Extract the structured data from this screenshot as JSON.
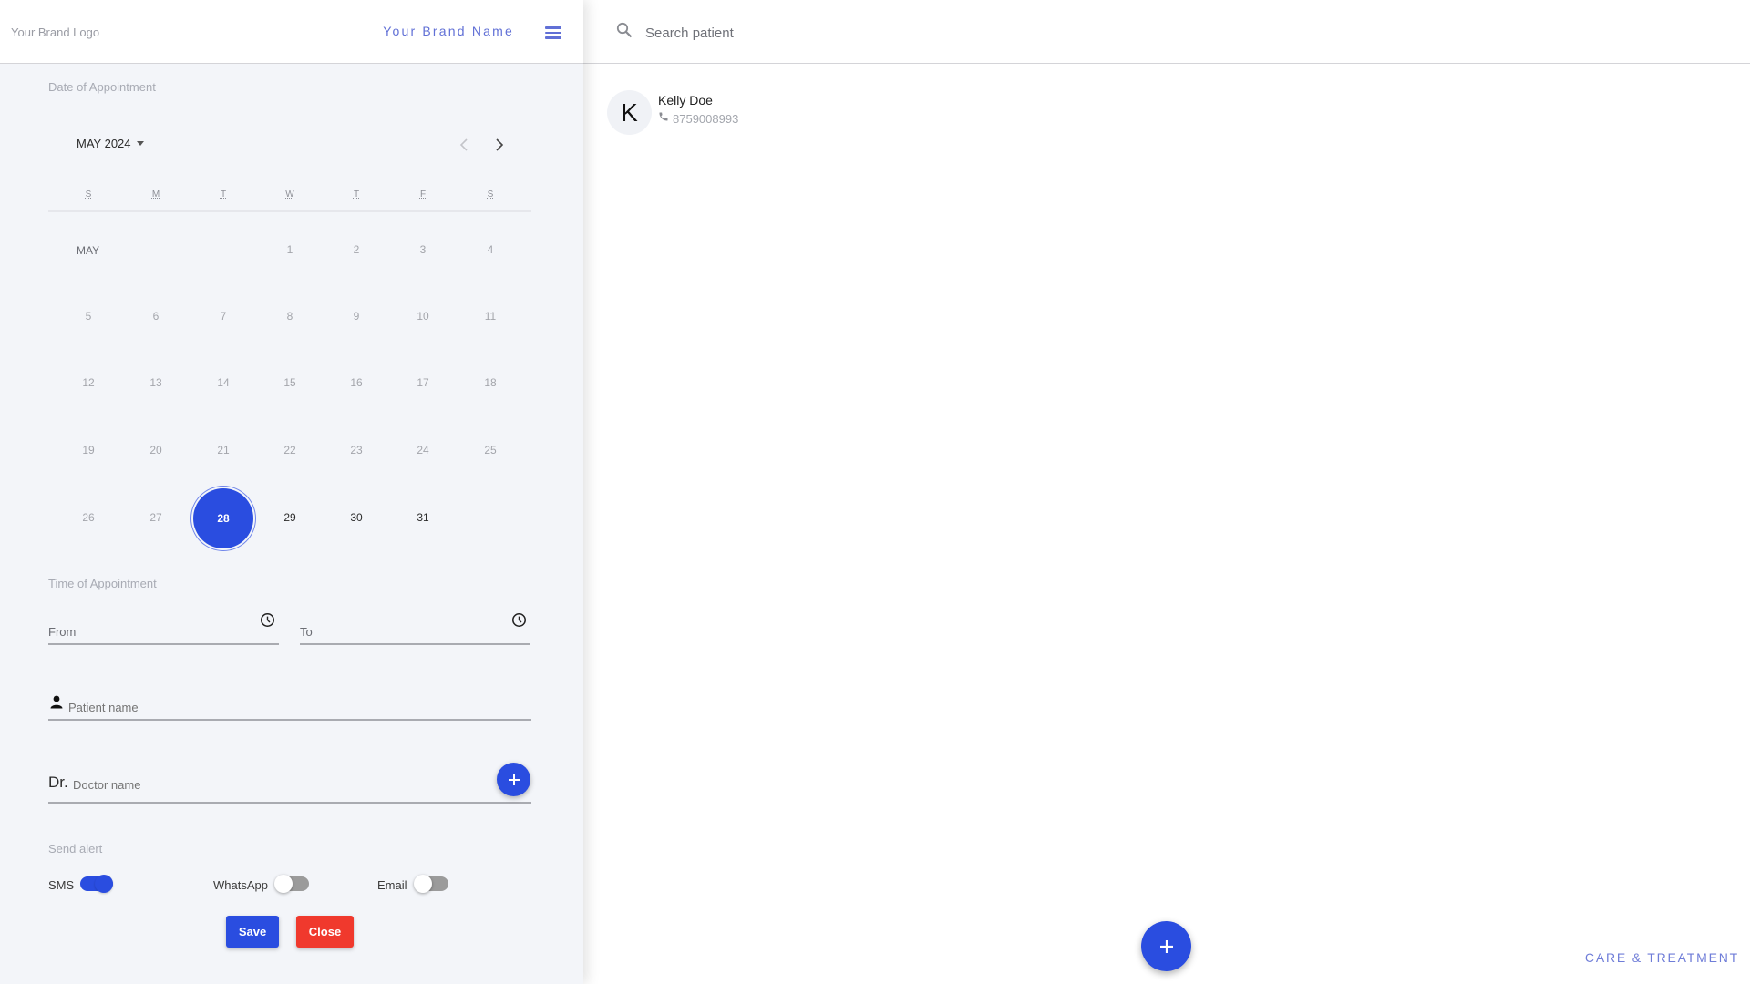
{
  "header": {
    "brand_logo": "Your Brand Logo",
    "brand_name": "Your Brand Name",
    "menu_icon": "hamburger-menu-icon"
  },
  "appointment_form": {
    "date_label": "Date of Appointment",
    "calendar": {
      "month_year": "MAY 2024",
      "month_short": "MAY",
      "weekdays": [
        "S",
        "M",
        "T",
        "W",
        "T",
        "F",
        "S"
      ],
      "first_weekday_index": 3,
      "days_in_month": 31,
      "selected_day": "28",
      "active_days_from": 28,
      "days": [
        "1",
        "2",
        "3",
        "4",
        "5",
        "6",
        "7",
        "8",
        "9",
        "10",
        "11",
        "12",
        "13",
        "14",
        "15",
        "16",
        "17",
        "18",
        "19",
        "20",
        "21",
        "22",
        "23",
        "24",
        "25",
        "26",
        "27",
        "28",
        "29",
        "30",
        "31"
      ],
      "prev_icon": "chevron-left-icon",
      "next_icon": "chevron-right-icon"
    },
    "time_label": "Time of Appointment",
    "from_label": "From",
    "to_label": "To",
    "from_value": "",
    "to_value": "",
    "patient_placeholder": "Patient name",
    "patient_value": "",
    "doctor_prefix": "Dr.",
    "doctor_placeholder": "Doctor name",
    "doctor_value": "",
    "alert_label": "Send alert",
    "alerts": [
      {
        "label": "SMS",
        "on": true
      },
      {
        "label": "WhatsApp",
        "on": false
      },
      {
        "label": "Email",
        "on": false
      }
    ],
    "save_label": "Save",
    "close_label": "Close"
  },
  "patients": {
    "search_placeholder": "Search patient",
    "search_value": "",
    "list": [
      {
        "initial": "K",
        "name": "Kelly Doe",
        "phone": "8759008993"
      }
    ]
  },
  "footer": {
    "brand_tagline": "CARE & TREATMENT"
  },
  "colors": {
    "accent": "#2a4de0",
    "danger": "#f0392d",
    "brand_text": "#6170d6",
    "panel_bg": "#f3f5f9"
  }
}
